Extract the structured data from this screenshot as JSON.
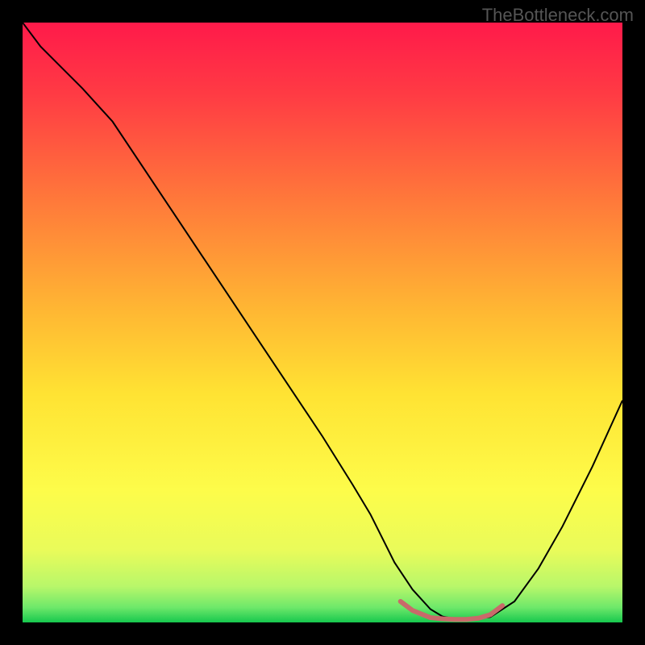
{
  "watermark": "TheBottleneck.com",
  "chart_data": {
    "type": "line",
    "title": "",
    "xlabel": "",
    "ylabel": "",
    "xlim": [
      0,
      100
    ],
    "ylim": [
      0,
      100
    ],
    "grid": false,
    "legend": false,
    "gradient_stops": [
      {
        "offset": 0.0,
        "color": "#ff1a4a"
      },
      {
        "offset": 0.12,
        "color": "#ff3b44"
      },
      {
        "offset": 0.3,
        "color": "#ff7a3a"
      },
      {
        "offset": 0.48,
        "color": "#ffb733"
      },
      {
        "offset": 0.62,
        "color": "#ffe333"
      },
      {
        "offset": 0.78,
        "color": "#fdfc4a"
      },
      {
        "offset": 0.88,
        "color": "#e9fb5a"
      },
      {
        "offset": 0.94,
        "color": "#b8f76a"
      },
      {
        "offset": 0.975,
        "color": "#6ee86a"
      },
      {
        "offset": 1.0,
        "color": "#17c84e"
      }
    ],
    "series": [
      {
        "name": "bottleneck-curve",
        "color": "#000000",
        "width": 2,
        "x": [
          0,
          3,
          6,
          10,
          15,
          20,
          25,
          30,
          35,
          40,
          45,
          50,
          55,
          58,
          60,
          62,
          65,
          68,
          70,
          72,
          75,
          78,
          82,
          86,
          90,
          95,
          100
        ],
        "y": [
          100,
          96,
          93,
          89,
          83.5,
          76,
          68.5,
          61,
          53.5,
          46,
          38.5,
          31,
          23,
          18,
          14,
          10,
          5.5,
          2.2,
          1.0,
          0.6,
          0.5,
          0.9,
          3.5,
          9,
          16,
          26,
          37
        ]
      },
      {
        "name": "optimal-range-marker",
        "color": "#c96a6a",
        "width": 6,
        "cap": "round",
        "x": [
          63,
          65,
          68,
          70,
          72,
          74,
          76,
          78,
          80
        ],
        "y": [
          3.5,
          2.0,
          0.8,
          0.6,
          0.5,
          0.5,
          0.7,
          1.3,
          2.8
        ]
      }
    ]
  }
}
